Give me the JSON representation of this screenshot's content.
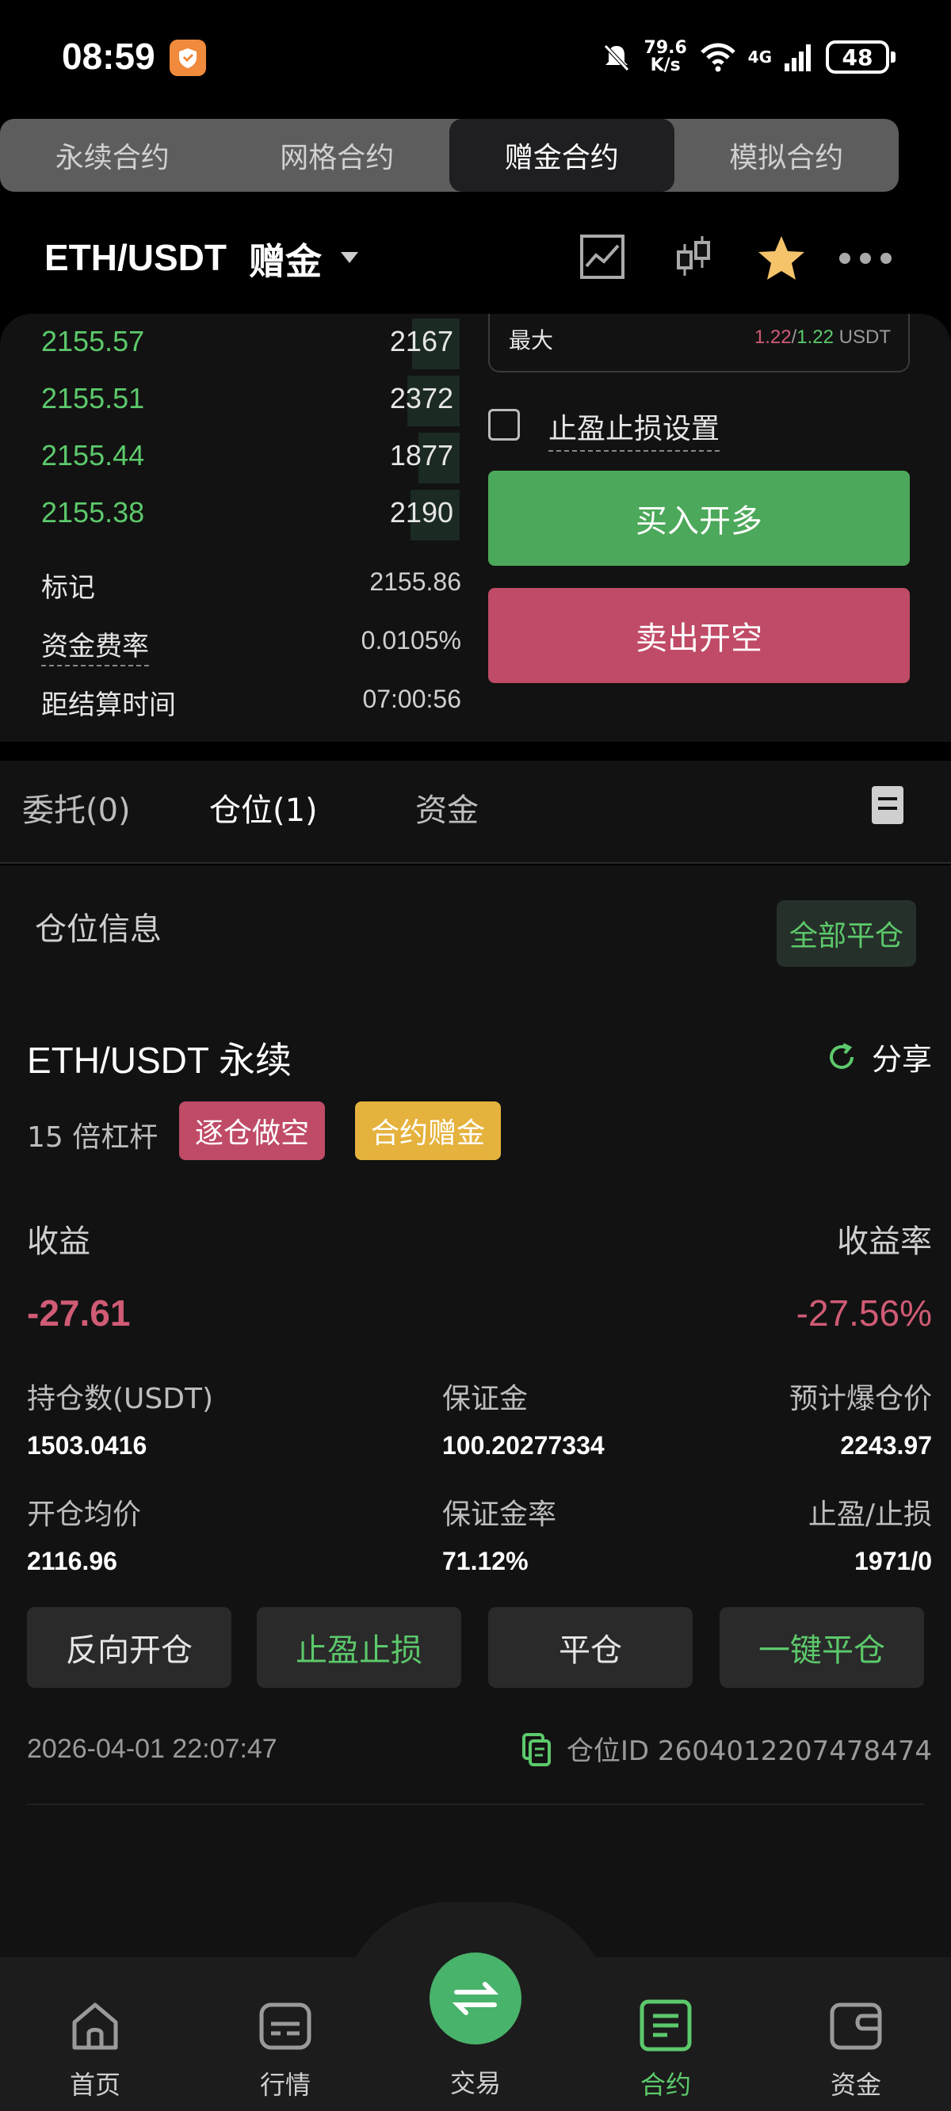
{
  "status": {
    "time": "08:59",
    "speed": "79.6\nK/s",
    "network": "4G",
    "battery": "48"
  },
  "contract_tabs": [
    "永续合约",
    "网格合约",
    "赠金合约",
    "模拟合约"
  ],
  "header": {
    "pair": "ETH/USDT",
    "tag": "赠金"
  },
  "orderbook": [
    {
      "price": "2155.57",
      "qty": "2167"
    },
    {
      "price": "2155.51",
      "qty": "2372"
    },
    {
      "price": "2155.44",
      "qty": "1877"
    },
    {
      "price": "2155.38",
      "qty": "2190"
    }
  ],
  "market_info": {
    "mark_label": "标记",
    "mark_value": "2155.86",
    "funding_label": "资金费率",
    "funding_value": "0.0105%",
    "settle_label": "距结算时间",
    "settle_value": "07:00:56"
  },
  "order_form": {
    "max_label": "最大",
    "max_a": "1.22",
    "max_sep": "/",
    "max_b": "1.22",
    "max_unit": " USDT",
    "tpsl_label": "止盈止损设置",
    "buy_label": "买入开多",
    "sell_label": "卖出开空"
  },
  "position_tabs": {
    "orders": "委托(0)",
    "positions": "仓位(1)",
    "assets": "资金"
  },
  "position": {
    "section_title": "仓位信息",
    "close_all": "全部平仓",
    "pair": "ETH/USDT",
    "pair_type": "永续",
    "share": "分享",
    "leverage": "15 倍杠杆",
    "badge_mode": "逐仓做空",
    "badge_bonus": "合约赠金",
    "pnl_label": "收益",
    "pnl_value": "-27.61",
    "roe_label": "收益率",
    "roe_value": "-27.56%",
    "size_label": "持仓数(USDT)",
    "size_value": "1503.0416",
    "margin_label": "保证金",
    "margin_value": "100.20277334",
    "liq_label": "预计爆仓价",
    "liq_value": "2243.97",
    "entry_label": "开仓均价",
    "entry_value": "2116.96",
    "margin_ratio_label": "保证金率",
    "margin_ratio_value": "71.12%",
    "tpsl_label": "止盈/止损",
    "tpsl_value": "1971/0",
    "actions": [
      "反向开仓",
      "止盈止损",
      "平仓",
      "一键平仓"
    ],
    "time": "2026-04-01 22:07:47",
    "id_text": "仓位ID 2604012207478474"
  },
  "nav": [
    "首页",
    "行情",
    "交易",
    "合约",
    "资金"
  ],
  "colors": {
    "green": "#5cc96b",
    "red": "#c04b67",
    "yellow": "#e5b23d"
  }
}
